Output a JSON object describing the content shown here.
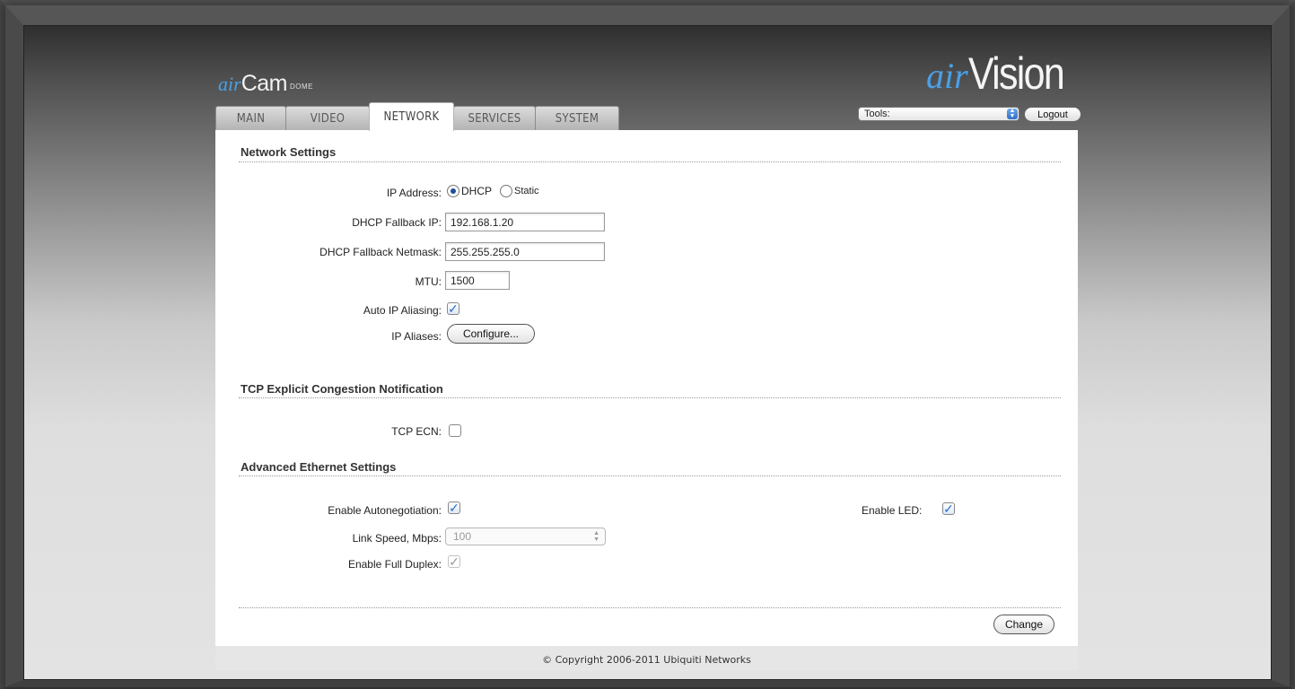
{
  "brand": {
    "left_logo_air": "air",
    "left_logo_cam": "Cam",
    "left_logo_dome": "DOME",
    "right_logo_air": "air",
    "right_logo_vision": "Vision"
  },
  "tabs": [
    {
      "label": "MAIN",
      "active": false
    },
    {
      "label": "VIDEO",
      "active": false
    },
    {
      "label": "NETWORK",
      "active": true
    },
    {
      "label": "SERVICES",
      "active": false
    },
    {
      "label": "SYSTEM",
      "active": false
    }
  ],
  "header": {
    "tools_value": "Tools:",
    "logout_label": "Logout"
  },
  "network_settings": {
    "title": "Network Settings",
    "ip_address_label": "IP Address:",
    "dhcp_label": "DHCP",
    "static_label": "Static",
    "ip_mode": "DHCP",
    "fallback_ip_label": "DHCP Fallback IP:",
    "fallback_ip_value": "192.168.1.20",
    "fallback_netmask_label": "DHCP Fallback Netmask:",
    "fallback_netmask_value": "255.255.255.0",
    "mtu_label": "MTU:",
    "mtu_value": "1500",
    "auto_alias_label": "Auto IP Aliasing:",
    "auto_alias_checked": true,
    "ip_aliases_label": "IP Aliases:",
    "configure_label": "Configure..."
  },
  "tcp_ecn": {
    "title": "TCP Explicit Congestion Notification",
    "ecn_label": "TCP ECN:",
    "ecn_checked": false
  },
  "advanced_ethernet": {
    "title": "Advanced Ethernet Settings",
    "autoneg_label": "Enable Autonegotiation:",
    "autoneg_checked": true,
    "link_speed_label": "Link Speed, Mbps:",
    "link_speed_value": "100",
    "full_duplex_label": "Enable Full Duplex:",
    "full_duplex_checked": true,
    "led_label": "Enable LED:",
    "led_checked": true
  },
  "actions": {
    "change_label": "Change"
  },
  "footer": {
    "copyright": "© Copyright 2006-2011 Ubiquiti Networks"
  },
  "icons": {
    "check": "checkmark-icon",
    "select_arrow": "updown-arrow-icon"
  },
  "colors": {
    "accent_blue": "#4aa0e6",
    "check_blue": "#2b6fc4"
  }
}
